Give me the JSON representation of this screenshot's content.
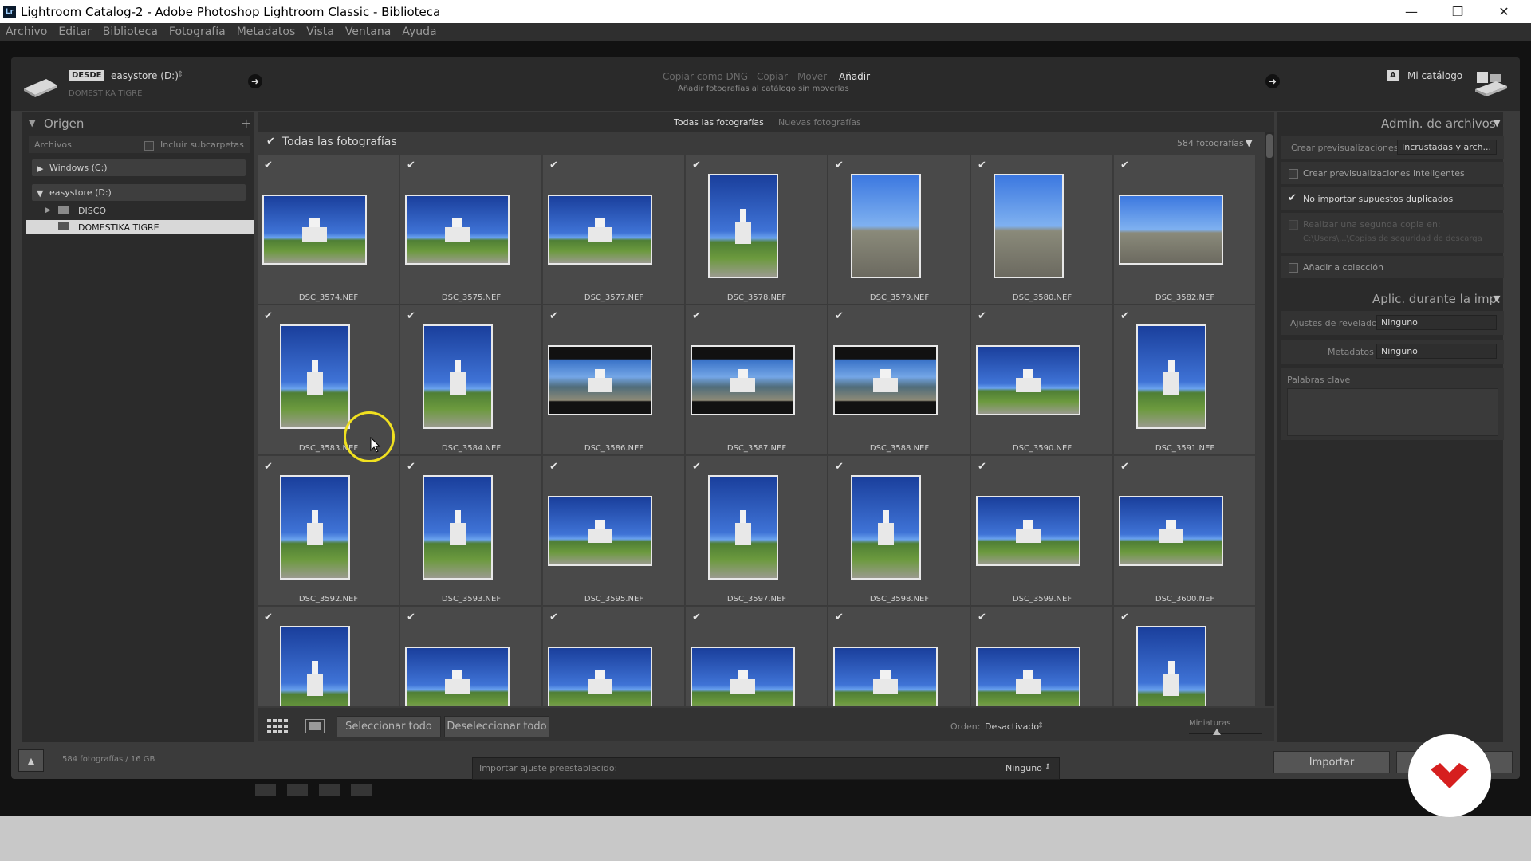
{
  "window": {
    "title": "Lightroom Catalog-2 - Adobe Photoshop Lightroom Classic - Biblioteca",
    "app_icon": "Lr"
  },
  "menu": [
    "Archivo",
    "Editar",
    "Biblioteca",
    "Fotografía",
    "Metadatos",
    "Vista",
    "Ventana",
    "Ayuda"
  ],
  "header": {
    "desde_label": "DESDE",
    "source_drive": "easystore (D:)",
    "source_path": "DOMESTIKA TIGRE",
    "modes": [
      "Copiar como DNG",
      "Copiar",
      "Mover",
      "Añadir"
    ],
    "active_mode": "Añadir",
    "mode_desc": "Añadir fotografías al catálogo sin moverlas",
    "dest_badge": "A",
    "dest_label": "Mi catálogo"
  },
  "left_panel": {
    "title": "Origen",
    "archivos_label": "Archivos",
    "incluir_label": "Incluir subcarpetas",
    "drives": [
      {
        "label": "Windows (C:)"
      },
      {
        "label": "easystore (D:)"
      }
    ],
    "folders": [
      {
        "label": "DISCO"
      },
      {
        "label": "DOMESTIKA TIGRE"
      }
    ]
  },
  "grid": {
    "tabs": [
      "Todas las fotografías",
      "Nuevas fotografías"
    ],
    "all_label": "Todas las fotografías",
    "count_label": "584 fotografías",
    "rows": [
      [
        "DSC_3574.NEF",
        "DSC_3575.NEF",
        "DSC_3577.NEF",
        "DSC_3578.NEF",
        "DSC_3579.NEF",
        "DSC_3580.NEF",
        "DSC_3582.NEF"
      ],
      [
        "DSC_3583.NEF",
        "DSC_3584.NEF",
        "DSC_3586.NEF",
        "DSC_3587.NEF",
        "DSC_3588.NEF",
        "DSC_3590.NEF",
        "DSC_3591.NEF"
      ],
      [
        "DSC_3592.NEF",
        "DSC_3593.NEF",
        "DSC_3595.NEF",
        "DSC_3597.NEF",
        "DSC_3598.NEF",
        "DSC_3599.NEF",
        "DSC_3600.NEF"
      ],
      [
        "",
        "",
        "",
        "",
        "",
        "",
        ""
      ]
    ]
  },
  "toolbar": {
    "select_all": "Seleccionar todo",
    "deselect_all": "Deseleccionar todo",
    "order_label": "Orden:",
    "order_value": "Desactivado",
    "thumbs_label": "Miniaturas"
  },
  "right_panel": {
    "file_handling_title": "Admin. de archivos",
    "crear_prev_label": "Crear previsualizaciones",
    "crear_prev_value": "Incrustadas y arch...",
    "intelligent_label": "Crear previsualizaciones inteligentes",
    "no_duplicates_label": "No importar supuestos duplicados",
    "second_copy_label": "Realizar una segunda copia en:",
    "second_copy_path": "C:\\Users\\...\\Copias de seguridad de descarga",
    "add_collection_label": "Añadir a colección",
    "apply_title": "Aplic. durante la imp.",
    "develop_label": "Ajustes de revelado",
    "develop_value": "Ninguno",
    "metadata_label": "Metadatos",
    "metadata_value": "Ninguno",
    "keywords_label": "Palabras clave"
  },
  "footer": {
    "status": "584 fotografías / 16 GB",
    "preset_label": "Importar ajuste preestablecido:",
    "preset_value": "Ninguno",
    "import_button": "Importar"
  },
  "colors": {
    "accent_red": "#d61f1f",
    "dialog_bg": "#3b3b3b"
  }
}
